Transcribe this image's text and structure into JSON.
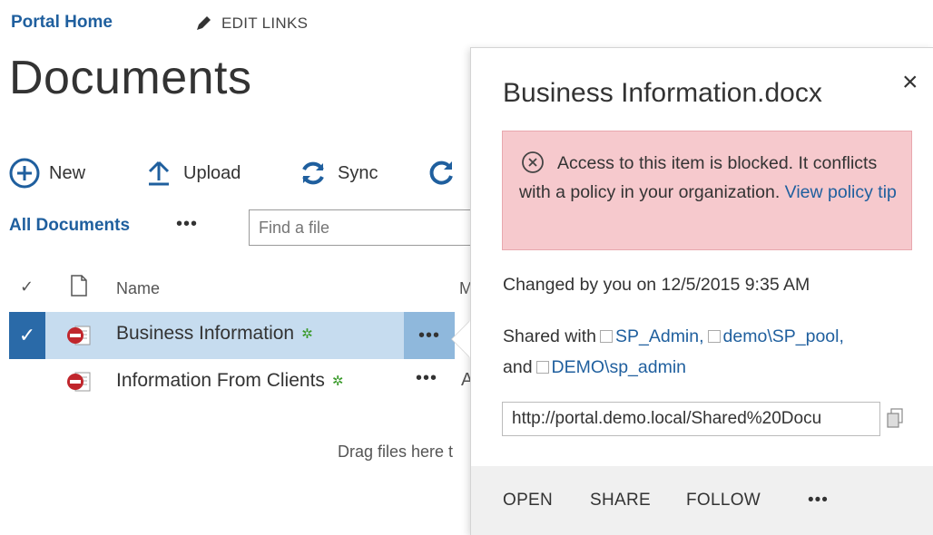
{
  "nav": {
    "portal_home": "Portal Home",
    "edit_links": "EDIT LINKS"
  },
  "page": {
    "title": "Documents"
  },
  "commands": {
    "new": "New",
    "upload": "Upload",
    "sync": "Sync"
  },
  "views": {
    "current": "All Documents",
    "more": "•••"
  },
  "search": {
    "placeholder": "Find a file"
  },
  "list": {
    "columns": {
      "name": "Name",
      "modified": "M"
    },
    "rows": [
      {
        "name": "Business Information",
        "more": "•••",
        "selected": true
      },
      {
        "name": "Information From Clients",
        "more": "•••",
        "modified_by": "A"
      }
    ],
    "drag_hint": "Drag files here t"
  },
  "callout": {
    "title": "Business Information.docx",
    "close": "×",
    "blocked_message": "Access to this item is blocked. It conflicts with a policy in your organization.",
    "policy_link": "View policy tip",
    "changed_by": "Changed by you on 12/5/2015 9:35 AM",
    "shared_prefix": "Shared with",
    "shared_users": [
      "SP_Admin,",
      "demo\\SP_pool,",
      "DEMO\\sp_admin"
    ],
    "shared_and": "and",
    "url": "http://portal.demo.local/Shared%20Docu",
    "actions": {
      "open": "OPEN",
      "share": "SHARE",
      "follow": "FOLLOW",
      "more": "•••"
    }
  },
  "colors": {
    "link": "#1f5f9e",
    "selected_row": "#c6dcef",
    "blocked_bg": "#f6c9cd"
  }
}
